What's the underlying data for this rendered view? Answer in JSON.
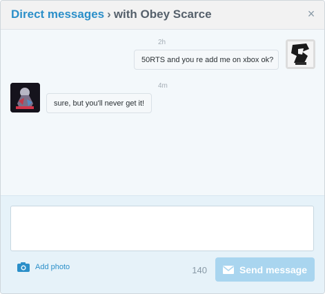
{
  "header": {
    "title_link": "Direct messages",
    "separator": "›",
    "conversation_with": "with Obey Scarce",
    "close_label": "×"
  },
  "messages": [
    {
      "timestamp": "2h",
      "text": "50RTS and you re add me on xbox ok?",
      "direction": "sent",
      "avatar": "user-avatar"
    },
    {
      "timestamp": "4m",
      "text": "sure, but you'll never get it!",
      "direction": "received",
      "avatar": "obey-scarce-avatar"
    }
  ],
  "composer": {
    "message_value": "",
    "add_photo_label": "Add photo",
    "char_count": "140",
    "send_label": "Send message"
  },
  "colors": {
    "accent": "#2b8fc9",
    "send_disabled": "#a9d5ef",
    "composer_bg": "#e6f2f9"
  }
}
